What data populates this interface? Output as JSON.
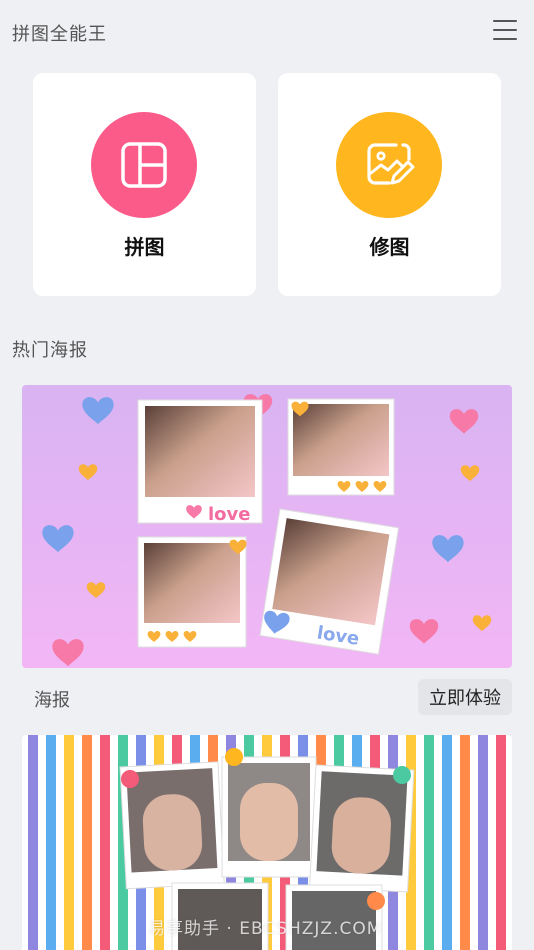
{
  "header": {
    "title": "拼图全能王",
    "menu_icon": "hamburger-menu-icon"
  },
  "tools": [
    {
      "label": "拼图",
      "icon": "collage-layout-icon",
      "color": "#fb5b89"
    },
    {
      "label": "修图",
      "icon": "photo-edit-icon",
      "color": "#ffb61f"
    }
  ],
  "section": {
    "title": "热门海报"
  },
  "posters": [
    {
      "caption": "海报",
      "button": "立即体验",
      "photo_stickers": [
        "love",
        "love"
      ]
    }
  ],
  "watermark": "易享助手 · EBCSHZJZ.COM",
  "colors": {
    "background": "#eff0f3",
    "card": "#ffffff",
    "pink": "#fb5b89",
    "orange": "#ffb61f"
  }
}
